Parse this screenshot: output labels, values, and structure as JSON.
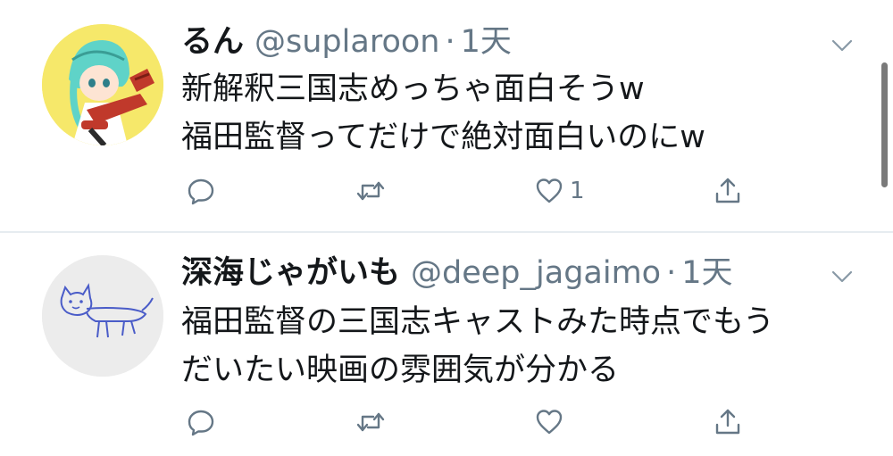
{
  "tweets": [
    {
      "display_name": "るん",
      "handle": "@suplaroon",
      "separator": "·",
      "time": "1天",
      "lines": [
        "新解釈三国志めっちゃ面白そうw",
        "福田監督ってだけで絶対面白いのにw"
      ],
      "reply_count": "",
      "retweet_count": "",
      "like_count": "1",
      "avatar_icon": "anime-character-avatar-icon"
    },
    {
      "display_name": "深海じゃがいも",
      "handle": "@deep_jagaimo",
      "separator": "·",
      "time": "1天",
      "lines": [
        "福田監督の三国志キャストみた時点でもう",
        "だいたい映画の雰囲気が分かる"
      ],
      "reply_count": "",
      "retweet_count": "",
      "like_count": "",
      "avatar_icon": "cat-drawing-avatar-icon"
    }
  ],
  "icons": {
    "reply": "reply-icon",
    "retweet": "retweet-icon",
    "like": "heart-icon",
    "share": "share-icon",
    "more": "chevron-down-icon"
  },
  "colors": {
    "text_primary": "#14171a",
    "text_secondary": "#657786",
    "divider": "#e6ecf0"
  }
}
